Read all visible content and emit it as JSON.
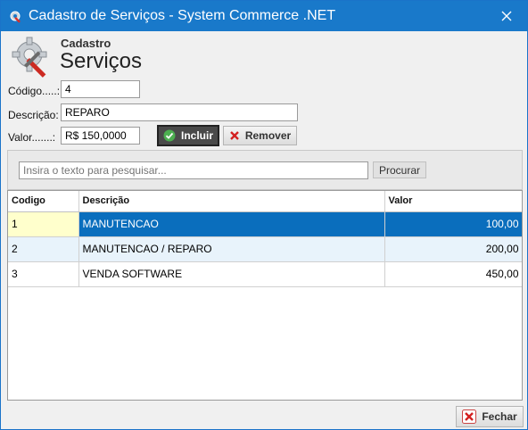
{
  "window": {
    "title": "Cadastro de Serviços - System Commerce .NET",
    "accent_color": "#1979ca",
    "title_icon": "settings-tools-icon",
    "close_icon": "close-icon"
  },
  "header": {
    "subtitle": "Cadastro",
    "title": "Serviços",
    "icon": "gear-tools-icon"
  },
  "form": {
    "codigo_label": "Código.....:",
    "codigo_value": "4",
    "descricao_label": "Descrição:",
    "descricao_value": "REPARO",
    "valor_label": "Valor.......:",
    "valor_value": "R$ 150,0000"
  },
  "buttons": {
    "incluir": "Incluir",
    "remover": "Remover",
    "procurar": "Procurar",
    "fechar": "Fechar"
  },
  "search": {
    "placeholder": "Insira o texto para pesquisar..."
  },
  "table": {
    "columns": [
      "Codigo",
      "Descrição",
      "Valor"
    ],
    "rows": [
      {
        "codigo": "1",
        "descricao": "MANUTENCAO",
        "valor": "100,00"
      },
      {
        "codigo": "2",
        "descricao": "MANUTENCAO / REPARO",
        "valor": "200,00"
      },
      {
        "codigo": "3",
        "descricao": "VENDA SOFTWARE",
        "valor": "450,00"
      }
    ]
  }
}
